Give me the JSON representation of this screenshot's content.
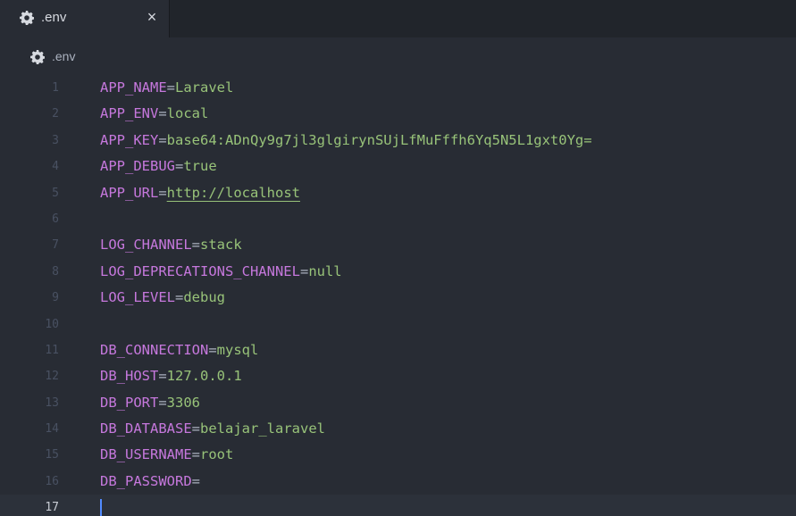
{
  "tab": {
    "title": ".env",
    "icon": "gear-icon",
    "close_glyph": "×"
  },
  "breadcrumb": {
    "icon": "gear-icon",
    "label": ".env"
  },
  "editor": {
    "current_line": 17,
    "colors": {
      "background": "#282c34",
      "key": "#c678dd",
      "value": "#98c379",
      "line_number": "#495162",
      "cursor": "#528bff"
    },
    "lines": [
      {
        "num": "1",
        "key": "APP_NAME",
        "eq": "=",
        "value": "Laravel"
      },
      {
        "num": "2",
        "key": "APP_ENV",
        "eq": "=",
        "value": "local"
      },
      {
        "num": "3",
        "key": "APP_KEY",
        "eq": "=",
        "value": "base64:ADnQy9g7jl3glgirynSUjLfMuFffh6Yq5N5L1gxt0Yg="
      },
      {
        "num": "4",
        "key": "APP_DEBUG",
        "eq": "=",
        "value": "true"
      },
      {
        "num": "5",
        "key": "APP_URL",
        "eq": "=",
        "value": "http://localhost"
      },
      {
        "num": "6",
        "key": "",
        "eq": "",
        "value": ""
      },
      {
        "num": "7",
        "key": "LOG_CHANNEL",
        "eq": "=",
        "value": "stack"
      },
      {
        "num": "8",
        "key": "LOG_DEPRECATIONS_CHANNEL",
        "eq": "=",
        "value": "null"
      },
      {
        "num": "9",
        "key": "LOG_LEVEL",
        "eq": "=",
        "value": "debug"
      },
      {
        "num": "10",
        "key": "",
        "eq": "",
        "value": ""
      },
      {
        "num": "11",
        "key": "DB_CONNECTION",
        "eq": "=",
        "value": "mysql"
      },
      {
        "num": "12",
        "key": "DB_HOST",
        "eq": "=",
        "value": "127.0.0.1"
      },
      {
        "num": "13",
        "key": "DB_PORT",
        "eq": "=",
        "value": "3306"
      },
      {
        "num": "14",
        "key": "DB_DATABASE",
        "eq": "=",
        "value": "belajar_laravel"
      },
      {
        "num": "15",
        "key": "DB_USERNAME",
        "eq": "=",
        "value": "root"
      },
      {
        "num": "16",
        "key": "DB_PASSWORD",
        "eq": "=",
        "value": ""
      },
      {
        "num": "17",
        "key": "",
        "eq": "",
        "value": ""
      }
    ]
  }
}
